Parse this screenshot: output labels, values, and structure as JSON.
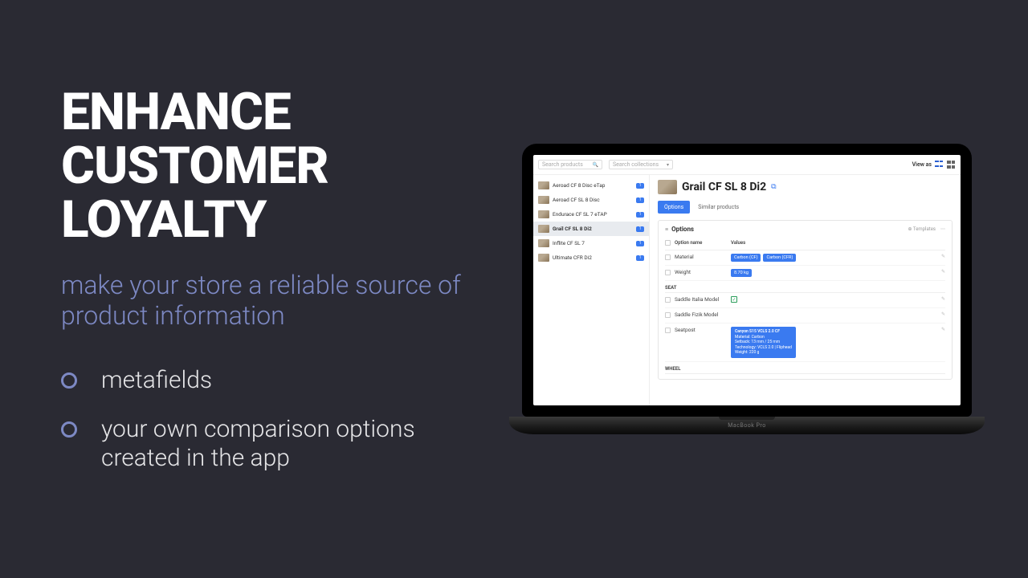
{
  "marketing": {
    "headline_l1": "ENHANCE",
    "headline_l2": "CUSTOMER",
    "headline_l3": "LOYALTY",
    "subhead": "make your store a reliable source of product information",
    "bullet1": "metafields",
    "bullet2": "your own comparison options created in the app"
  },
  "laptop_brand": "MacBook Pro",
  "app": {
    "search_products_ph": "Search products",
    "search_collections_ph": "Search collections",
    "view_as_label": "View as",
    "sidebar": {
      "items": [
        {
          "label": "Aeroad CF 8 Disc eTap",
          "badge": "1",
          "active": false
        },
        {
          "label": "Aeroad CF SL 8 Disc",
          "badge": "1",
          "active": false
        },
        {
          "label": "Endurace CF SL 7 eTAP",
          "badge": "1",
          "active": false
        },
        {
          "label": "Grail CF SL 8 Di2",
          "badge": "1",
          "active": true
        },
        {
          "label": "Inflite CF SL 7",
          "badge": "1",
          "active": false
        },
        {
          "label": "Ultimate CFR Di2",
          "badge": "1",
          "active": false
        }
      ]
    },
    "product": {
      "title": "Grail CF SL 8 Di2",
      "tabs": {
        "options": "Options",
        "similar": "Similar products"
      },
      "panel_title": "Options",
      "templates_label": "Templates",
      "columns": {
        "name": "Option name",
        "values": "Values"
      },
      "rows": {
        "material": {
          "name": "Material",
          "v1": "Carbon (CF)",
          "v2": "Carbon (CFR)"
        },
        "weight": {
          "name": "Weight",
          "v": "8.70 kg"
        }
      },
      "section_seat": "SEAT",
      "seat_rows": {
        "italia": {
          "name": "Saddle Italia Model"
        },
        "fizik": {
          "name": "Saddle Fizik Model"
        },
        "seatpost": {
          "name": "Seatpost",
          "line1": "Canyon S15 VCLS 2.0 CF",
          "line2": "Material: Carbon",
          "line3": "Setback: 13 mm / 25 mm",
          "line4": "Technology: VCLS 2.0 | Fliphead",
          "line5": "Weight: 220 g"
        }
      },
      "section_wheel": "WHEEL"
    }
  }
}
